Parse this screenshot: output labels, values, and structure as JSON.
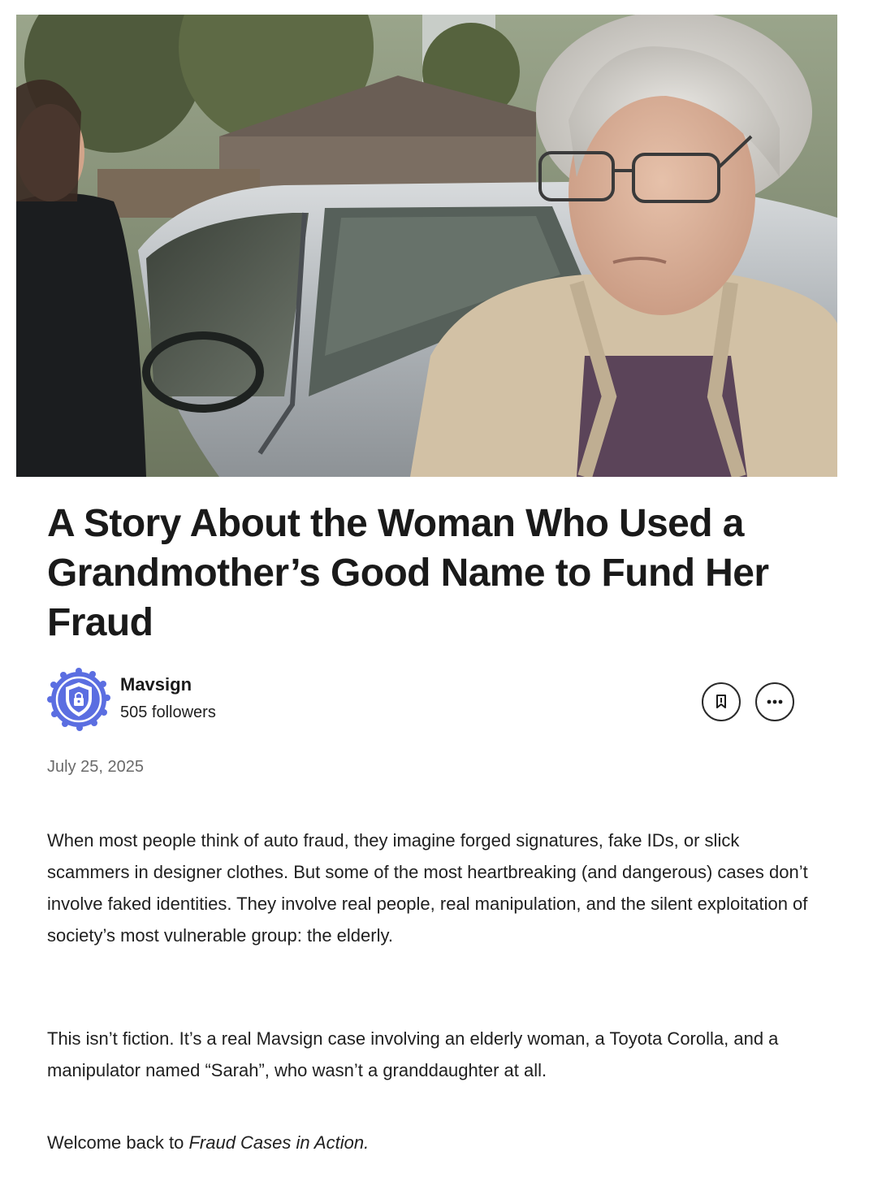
{
  "article": {
    "hero_image": {
      "subject": "elderly woman with glasses in beige cardigan standing beside a silver car, younger woman in dark hoodie on the left"
    },
    "title": "A Story About the Woman Who Used a Grandmother’s Good Name to Fund Her Fraud",
    "author": {
      "name": "Mavsign",
      "followers": "505 followers",
      "avatar_icon": "shield-lock-icon",
      "avatar_color": "#5b6ee1"
    },
    "actions": {
      "bookmark_icon": "bookmark-icon",
      "more_icon": "more-dots-icon"
    },
    "date": "July 25, 2025",
    "paragraphs": {
      "p1": "When most people think of auto fraud, they imagine forged signatures, fake IDs, or slick scammers in designer clothes. But some of the most heartbreaking (and dangerous) cases don’t involve faked identities. They involve real people, real manipulation, and the silent exploitation of society’s most vulnerable group: the elderly.",
      "p2": "This isn’t fiction. It’s a real Mavsign case involving an elderly woman, a Toyota Corolla, and a manipulator named “Sarah”, who wasn’t a granddaughter at all.",
      "p3_prefix": "Welcome back to ",
      "p3_italic": "Fraud Cases in Action."
    }
  }
}
